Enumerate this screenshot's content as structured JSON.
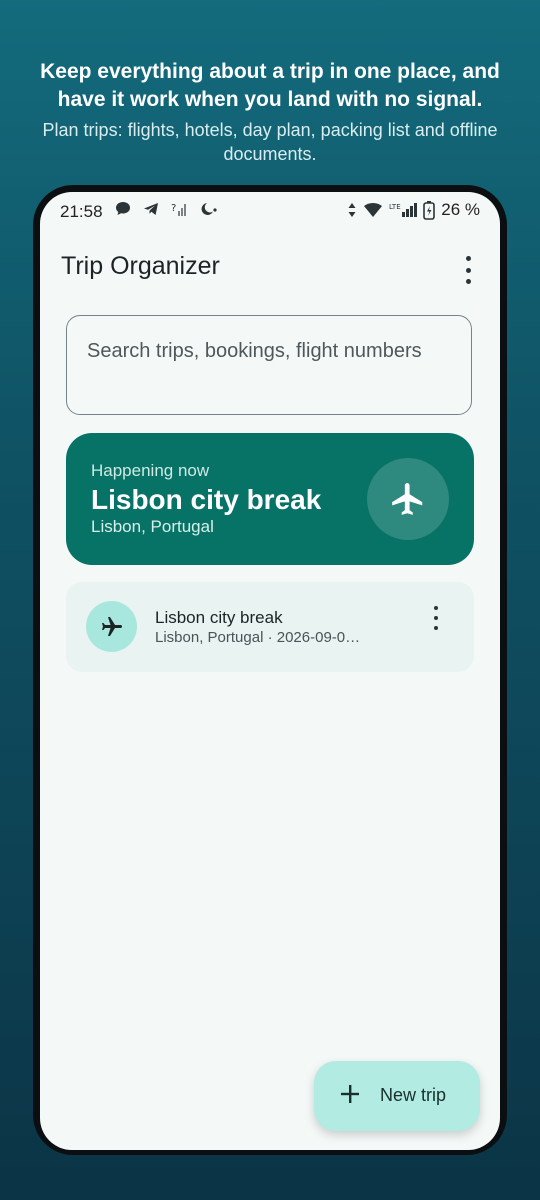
{
  "promo": {
    "headline": "Keep everything about a trip in one place, and have it work when you land with no signal.",
    "subhead": "Plan trips: flights, hotels, day plan, packing list and offline documents."
  },
  "status_bar": {
    "time": "21:58",
    "battery": "26 %",
    "network": "LTE",
    "left_icons": [
      "chat-icon",
      "telegram-icon",
      "signal-off-icon",
      "moon-icon"
    ],
    "right_icons": [
      "data-arrows-icon",
      "wifi-icon",
      "cell-signal-icon",
      "battery-icon"
    ]
  },
  "app": {
    "title": "Trip Organizer",
    "search_placeholder": "Search trips, bookings, flight numbers"
  },
  "hero": {
    "kicker": "Happening now",
    "title": "Lisbon city break",
    "location": "Lisbon, Portugal",
    "icon": "airplane-icon"
  },
  "trips": [
    {
      "title": "Lisbon city break",
      "subtitle": "Lisbon, Portugal · 2026-09-0…",
      "icon": "airplane-icon"
    }
  ],
  "fab": {
    "label": "New trip",
    "icon": "plus-icon"
  },
  "colors": {
    "hero_bg": "#077366",
    "avatar_bg": "#a7e7dd",
    "fab_bg": "#b2ebe2",
    "screen_bg": "#f4f9f8"
  }
}
